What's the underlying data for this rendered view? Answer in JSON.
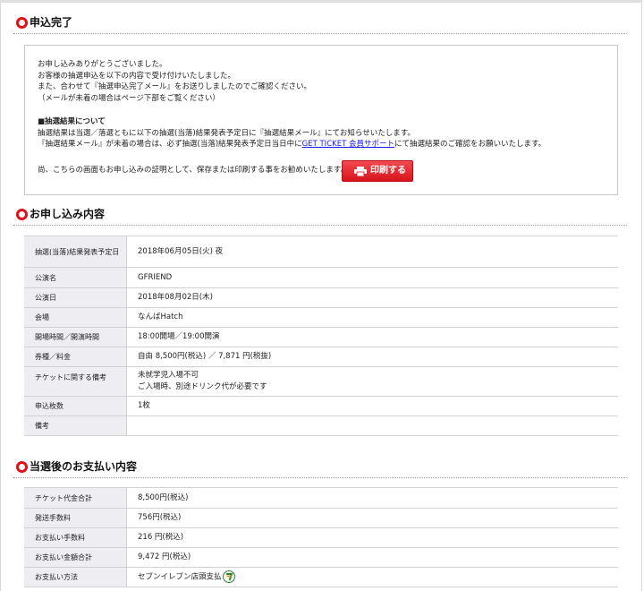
{
  "sections": {
    "complete": {
      "title": "申込完了"
    },
    "details": {
      "title": "お申し込み内容"
    },
    "payment": {
      "title": "当選後のお支払い内容"
    }
  },
  "notice": {
    "thanks_lines": [
      "お申し込みありがとうございました。",
      "お客様の抽選申込を以下の内容で受け付けいたしました。",
      "また、合わせて『抽選申込完了メール』をお送りしましたのでご確認ください。",
      "（メールが未着の場合はページ下部をご覧ください）"
    ],
    "result_heading": "■抽選結果について",
    "result_line1": "抽選結果は当選／落選ともに以下の抽選(当落)結果発表予定日に『抽選結果メール』にてお知らせいたします。",
    "result_line2_before": "『抽選結果メール』が未着の場合は、必ず抽選(当落)結果発表予定日当日中に",
    "result_line2_link": "GET TICKET 会員サポート",
    "result_line2_after": "にて抽選結果のご確認をお願いいたします。",
    "print_note": "尚、こちらの画面もお申し込みの証明として、保存または印刷する事をお勧めいたします。",
    "print_button_label": "印刷する",
    "print_icon": "printer-icon"
  },
  "details_rows": [
    {
      "label": "抽選(当落)結果発表予定日",
      "value": "2018年06月05日(火) 夜"
    },
    {
      "label": "公演名",
      "value": "GFRIEND"
    },
    {
      "label": "公演日",
      "value": "2018年08月02日(木)"
    },
    {
      "label": "会場",
      "value": "なんばHatch"
    },
    {
      "label": "開場時間／開演時間",
      "value": "18:00開場／19:00開演"
    },
    {
      "label": "券種／料金",
      "value": "自由 8,500円(税込) ／ 7,871 円(税抜)"
    },
    {
      "label": "チケットに関する備考",
      "value_line1": "未就学児入場不可",
      "value_line2": "ご入場時、別途ドリンク代が必要です"
    },
    {
      "label": "申込枚数",
      "value": "1枚"
    },
    {
      "label": "備考",
      "value": ""
    }
  ],
  "payment_rows": [
    {
      "label": "チケット代金合計",
      "value": "8,500円(税込)"
    },
    {
      "label": "発送手数料",
      "value": "756円(税込)"
    },
    {
      "label": "お支払い手数料",
      "value": "216 円(税込)"
    },
    {
      "label": "お支払い金額合計",
      "value": "9,472 円(税込)"
    },
    {
      "label": "お支払い方法",
      "value": "セブンイレブン店頭支払",
      "icon": "seven-eleven-icon"
    }
  ],
  "colors": {
    "accent_red": "#e0101c",
    "link_blue": "#1a1aee",
    "header_cell_bg": "#eeeef2",
    "seven_green": "#2a8a3a",
    "seven_orange": "#f08a18"
  }
}
